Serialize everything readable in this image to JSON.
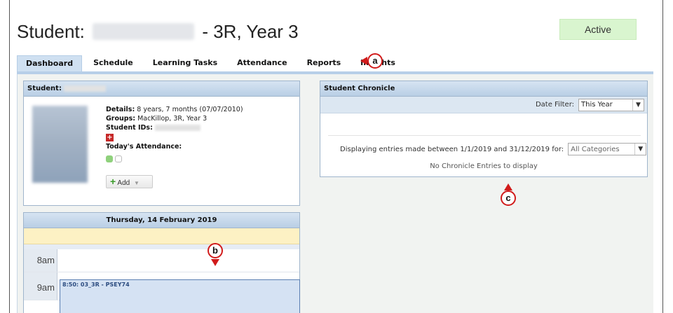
{
  "header": {
    "title_prefix": "Student:",
    "title_suffix": "- 3R, Year 3",
    "status": "Active"
  },
  "tabs": [
    {
      "label": "Dashboard",
      "active": true
    },
    {
      "label": "Schedule",
      "active": false
    },
    {
      "label": "Learning Tasks",
      "active": false
    },
    {
      "label": "Attendance",
      "active": false
    },
    {
      "label": "Reports",
      "active": false
    },
    {
      "label": "Insights",
      "active": false
    }
  ],
  "student_panel": {
    "title": "Student:",
    "details_label": "Details:",
    "details_value": "8 years, 7 months (07/07/2010)",
    "groups_label": "Groups:",
    "groups_value": "MacKillop, 3R, Year 3",
    "ids_label": "Student IDs:",
    "attendance_label": "Today's Attendance:",
    "add_label": "Add"
  },
  "chronicle_panel": {
    "title": "Student Chronicle",
    "date_filter_label": "Date Filter:",
    "date_filter_value": "This Year",
    "displaying_text": "Displaying entries made between 1/1/2019 and 31/12/2019 for:",
    "category_value": "All Categories",
    "empty_text": "No Chronicle Entries to display"
  },
  "calendar_panel": {
    "date": "Thursday, 14 February 2019",
    "hours": [
      "8am",
      "9am"
    ],
    "event_text": "8:50: 03_3R - PSEY74"
  },
  "callouts": [
    "a",
    "b",
    "c"
  ],
  "colors": {
    "callout_border": "#d11b1b",
    "active_status_bg": "#d9f5cf",
    "attendance_present": "#8fd17c",
    "event_bg": "#d5e2f3"
  }
}
